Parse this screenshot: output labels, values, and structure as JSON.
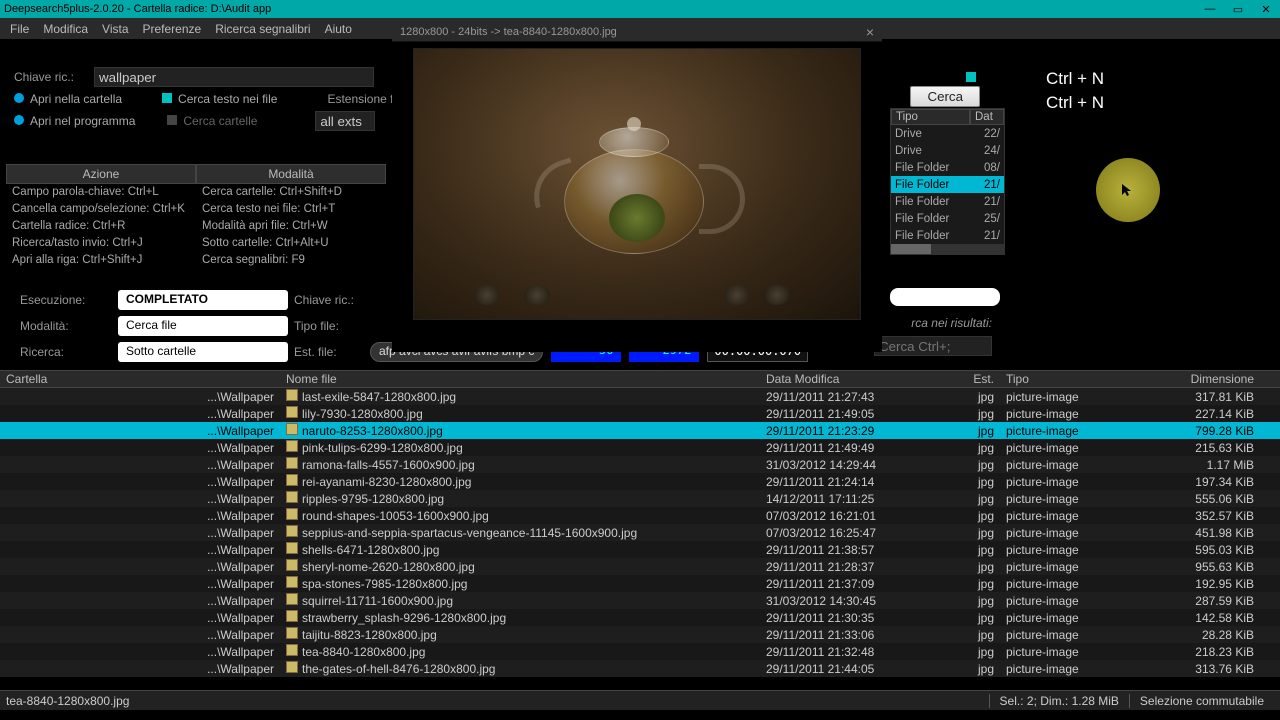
{
  "window": {
    "title": "Deepsearch5plus-2.0.20 - Cartella radice: D:\\Audit app"
  },
  "title_controls": {
    "min": "—",
    "max": "▭",
    "close": "✕"
  },
  "menu": [
    "File",
    "Modifica",
    "Vista",
    "Preferenze",
    "Ricerca segnalibri",
    "Aiuto"
  ],
  "search": {
    "key_label": "Chiave ric.:",
    "key_value": "wallpaper",
    "opt_open_folder": "Apri nella cartella",
    "opt_open_program": "Apri nel programma",
    "opt_search_text": "Cerca testo nei file",
    "opt_search_folders": "Cerca cartelle",
    "ext_label": "Estensione file",
    "ext_value": "all exts"
  },
  "shortcut_headers": {
    "a": "Azione",
    "b": "Modalità"
  },
  "shortcuts_a": [
    "Campo parola-chiave: Ctrl+L",
    "Cancella campo/selezione: Ctrl+K",
    "Cartella radice: Ctrl+R",
    "Ricerca/tasto invio: Ctrl+J",
    "Apri alla riga: Ctrl+Shift+J"
  ],
  "shortcuts_b": [
    "Cerca cartelle: Ctrl+Shift+D",
    "Cerca testo nei file: Ctrl+T",
    "Modalità apri file: Ctrl+W",
    "Sotto cartelle: Ctrl+Alt+U",
    "Cerca segnalibri: F9"
  ],
  "status": {
    "exec_l": "Esecuzione:",
    "exec_v": "COMPLETATO",
    "mode_l": "Modalità:",
    "mode_v": "Cerca file",
    "search_l": "Ricerca:",
    "search_v": "Sotto cartelle",
    "key_l": "Chiave ric.:",
    "type_l": "Tipo file:",
    "ext_l": "Est. file:",
    "ext_pill": "afp avci avcs avif avifs bmp c",
    "lcd1": "56",
    "lcd2": "2972",
    "timer": "00:00:00.070"
  },
  "right": {
    "search_btn": "Cerca",
    "cols": {
      "a": "Tipo",
      "b": "Dat"
    },
    "rows": [
      {
        "t": "Drive",
        "d": "22/"
      },
      {
        "t": "Drive",
        "d": "24/"
      },
      {
        "t": "File Folder",
        "d": "08/"
      },
      {
        "t": "File Folder",
        "d": "21/",
        "sel": true
      },
      {
        "t": "File Folder",
        "d": "21/"
      },
      {
        "t": "File Folder",
        "d": "25/"
      },
      {
        "t": "File Folder",
        "d": "21/"
      }
    ],
    "res_label": "rca nei risultati:",
    "res_ph": "Cerca Ctrl+;"
  },
  "hint": {
    "l1": "Ctrl + N",
    "l2": "Ctrl + N"
  },
  "preview": {
    "bar": "1280x800 - 24bits -> tea-8840-1280x800.jpg",
    "close": "×"
  },
  "grid": {
    "headers": {
      "folder": "Cartella",
      "name": "Nome file",
      "date": "Data Modifica",
      "ext": "Est.",
      "type": "Tipo",
      "size": "Dimensione"
    },
    "rows": [
      {
        "f": "...\\Wallpaper",
        "n": "last-exile-5847-1280x800.jpg",
        "d": "29/11/2011 21:27:43",
        "e": "jpg",
        "t": "picture-image",
        "s": "317.81 KiB"
      },
      {
        "f": "...\\Wallpaper",
        "n": "lily-7930-1280x800.jpg",
        "d": "29/11/2011 21:49:05",
        "e": "jpg",
        "t": "picture-image",
        "s": "227.14 KiB"
      },
      {
        "f": "...\\Wallpaper",
        "n": "naruto-8253-1280x800.jpg",
        "d": "29/11/2011 21:23:29",
        "e": "jpg",
        "t": "picture-image",
        "s": "799.28 KiB",
        "sel": true
      },
      {
        "f": "...\\Wallpaper",
        "n": "pink-tulips-6299-1280x800.jpg",
        "d": "29/11/2011 21:49:49",
        "e": "jpg",
        "t": "picture-image",
        "s": "215.63 KiB"
      },
      {
        "f": "...\\Wallpaper",
        "n": "ramona-falls-4557-1600x900.jpg",
        "d": "31/03/2012 14:29:44",
        "e": "jpg",
        "t": "picture-image",
        "s": "1.17 MiB"
      },
      {
        "f": "...\\Wallpaper",
        "n": "rei-ayanami-8230-1280x800.jpg",
        "d": "29/11/2011 21:24:14",
        "e": "jpg",
        "t": "picture-image",
        "s": "197.34 KiB"
      },
      {
        "f": "...\\Wallpaper",
        "n": "ripples-9795-1280x800.jpg",
        "d": "14/12/2011 17:11:25",
        "e": "jpg",
        "t": "picture-image",
        "s": "555.06 KiB"
      },
      {
        "f": "...\\Wallpaper",
        "n": "round-shapes-10053-1600x900.jpg",
        "d": "07/03/2012 16:21:01",
        "e": "jpg",
        "t": "picture-image",
        "s": "352.57 KiB"
      },
      {
        "f": "...\\Wallpaper",
        "n": "seppius-and-seppia-spartacus-vengeance-11145-1600x900.jpg",
        "d": "07/03/2012 16:25:47",
        "e": "jpg",
        "t": "picture-image",
        "s": "451.98 KiB"
      },
      {
        "f": "...\\Wallpaper",
        "n": "shells-6471-1280x800.jpg",
        "d": "29/11/2011 21:38:57",
        "e": "jpg",
        "t": "picture-image",
        "s": "595.03 KiB"
      },
      {
        "f": "...\\Wallpaper",
        "n": "sheryl-nome-2620-1280x800.jpg",
        "d": "29/11/2011 21:28:37",
        "e": "jpg",
        "t": "picture-image",
        "s": "955.63 KiB"
      },
      {
        "f": "...\\Wallpaper",
        "n": "spa-stones-7985-1280x800.jpg",
        "d": "29/11/2011 21:37:09",
        "e": "jpg",
        "t": "picture-image",
        "s": "192.95 KiB"
      },
      {
        "f": "...\\Wallpaper",
        "n": "squirrel-11711-1600x900.jpg",
        "d": "31/03/2012 14:30:45",
        "e": "jpg",
        "t": "picture-image",
        "s": "287.59 KiB"
      },
      {
        "f": "...\\Wallpaper",
        "n": "strawberry_splash-9296-1280x800.jpg",
        "d": "29/11/2011 21:30:35",
        "e": "jpg",
        "t": "picture-image",
        "s": "142.58 KiB"
      },
      {
        "f": "...\\Wallpaper",
        "n": "taijitu-8823-1280x800.jpg",
        "d": "29/11/2011 21:33:06",
        "e": "jpg",
        "t": "picture-image",
        "s": "28.28 KiB"
      },
      {
        "f": "...\\Wallpaper",
        "n": "tea-8840-1280x800.jpg",
        "d": "29/11/2011 21:32:48",
        "e": "jpg",
        "t": "picture-image",
        "s": "218.23 KiB"
      },
      {
        "f": "...\\Wallpaper",
        "n": "the-gates-of-hell-8476-1280x800.jpg",
        "d": "29/11/2011 21:44:05",
        "e": "jpg",
        "t": "picture-image",
        "s": "313.76 KiB"
      }
    ]
  },
  "statusbar": {
    "file": "tea-8840-1280x800.jpg",
    "sel": "Sel.: 2; Dim.: 1.28 MiB",
    "toggle": "Selezione commutabile"
  }
}
